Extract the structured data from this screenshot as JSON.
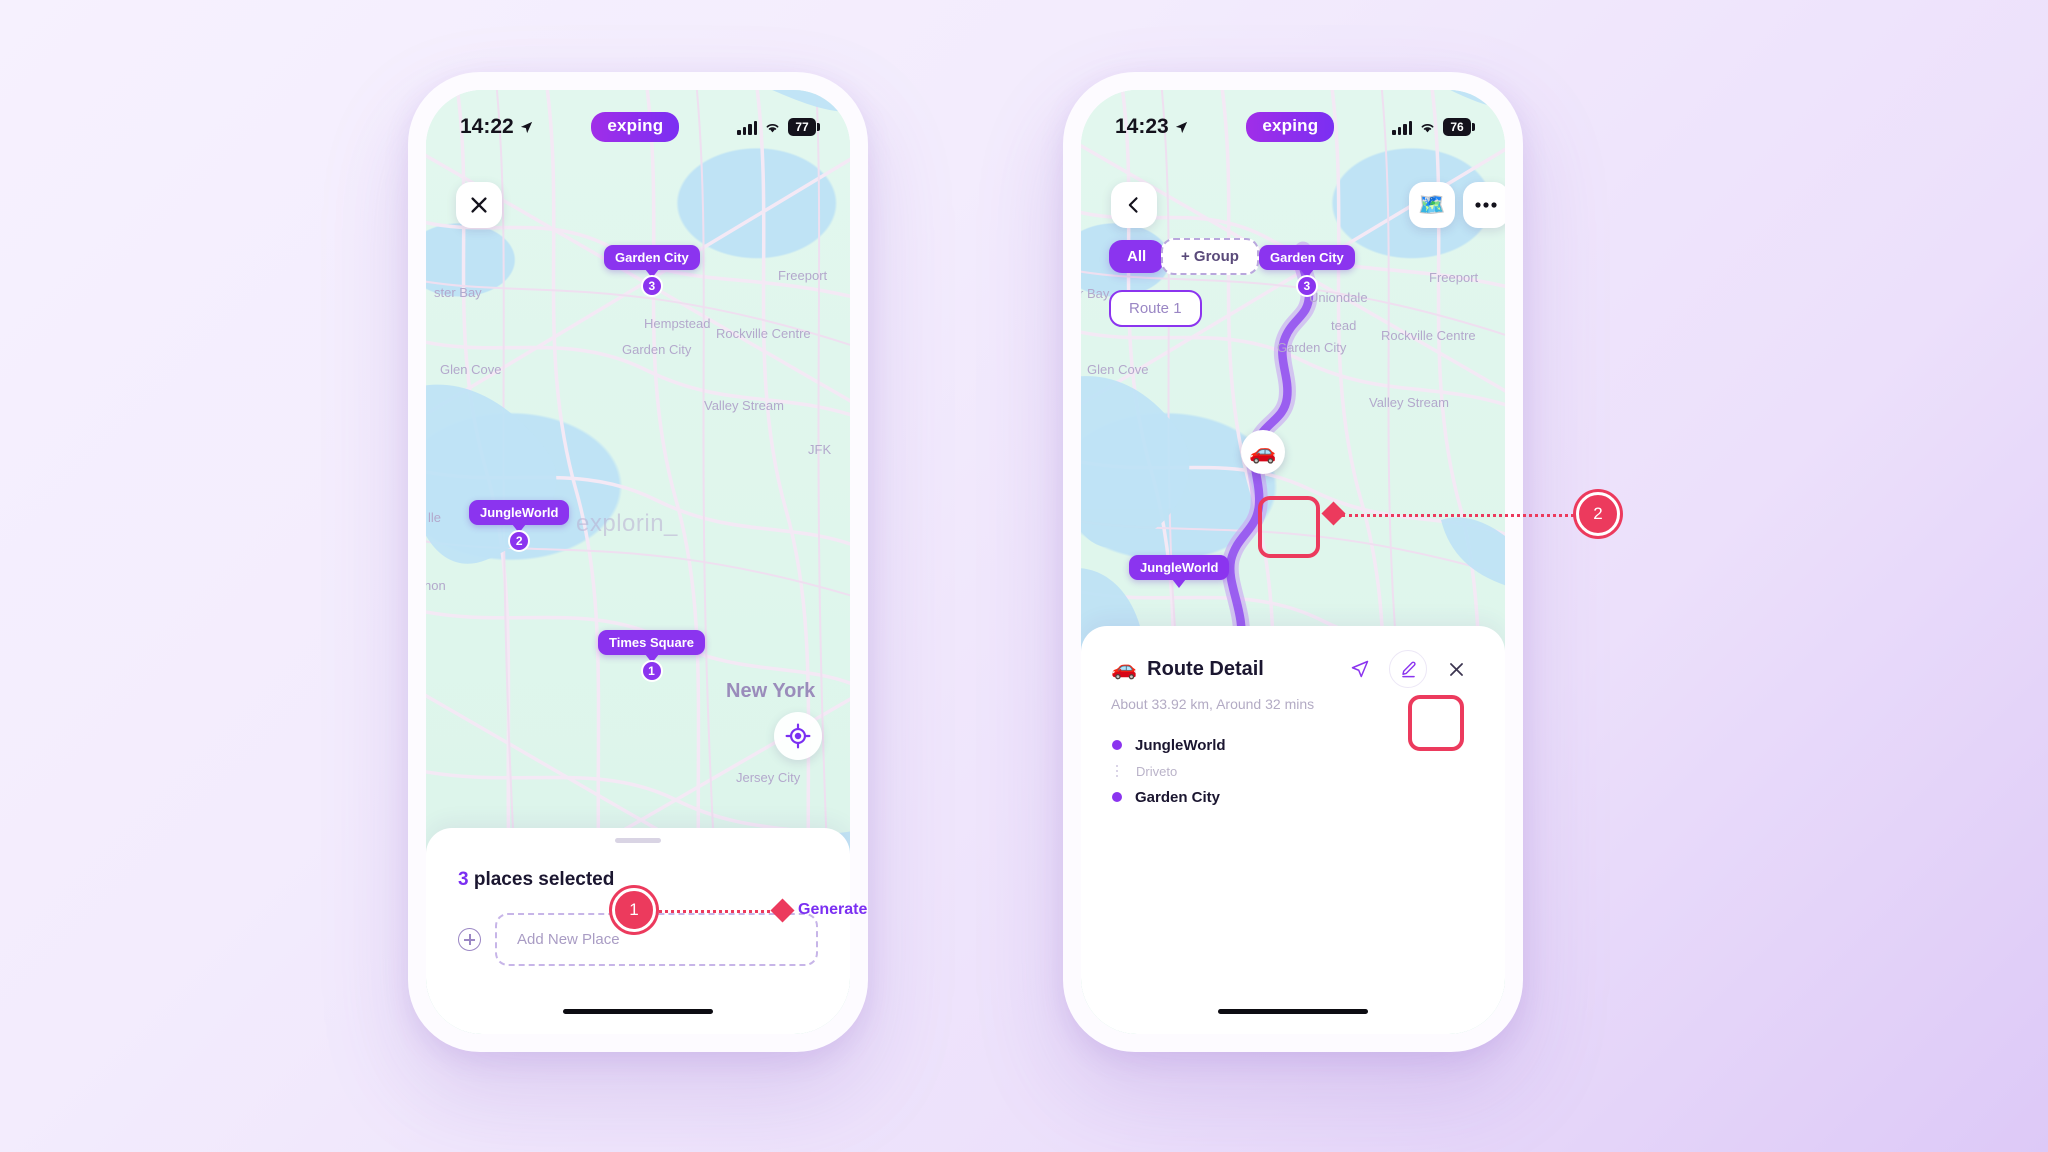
{
  "app": {
    "brand": "exping",
    "watermark": "explorin_"
  },
  "phone1": {
    "status": {
      "time": "14:22",
      "battery": "77",
      "location_icon": "location-arrow-icon",
      "signal_icon": "signal-bars-icon",
      "wifi_icon": "wifi-icon"
    },
    "controls": {
      "close_icon": "close-icon",
      "locate_icon": "locate-crosshair-icon"
    },
    "pins": [
      {
        "label": "Garden City",
        "number": "3"
      },
      {
        "label": "JungleWorld",
        "number": "2"
      },
      {
        "label": "Times Square",
        "number": "1"
      }
    ],
    "map_labels": [
      "ster Bay",
      "Freeport",
      "Glen Cove",
      "Rockville Centre",
      "Hempstead",
      "Garden City",
      "Valley Stream",
      "JFK",
      "New York",
      "Jersey City",
      "non",
      "lle"
    ],
    "sheet": {
      "count": "3",
      "count_suffix": " places selected",
      "add_placeholder": "Add New Place",
      "add_icon": "plus-circle-icon"
    }
  },
  "phone2": {
    "status": {
      "time": "14:23",
      "battery": "76",
      "location_icon": "location-arrow-icon",
      "signal_icon": "signal-bars-icon",
      "wifi_icon": "wifi-icon"
    },
    "controls": {
      "back_icon": "chevron-left-icon",
      "map_icon": "map-layers-icon",
      "more_icon": "more-horizontal-icon"
    },
    "chips": {
      "all": "All",
      "group": "+ Group",
      "route": "Route 1"
    },
    "pins": [
      {
        "label": "Garden City",
        "number": "3"
      },
      {
        "label": "JungleWorld",
        "number": ""
      }
    ],
    "car_marker_icon": "car-icon",
    "map_labels": [
      "Freeport",
      "Uniondale",
      "Rockville Centre",
      "Valley Stream",
      "Glen Cove",
      "Garden City",
      "tead",
      "r Bay"
    ],
    "route_detail": {
      "icon": "car-icon",
      "title": "Route Detail",
      "subtitle": "About 33.92 km, Around 32 mins",
      "send_icon": "send-icon",
      "edit_icon": "pencil-icon",
      "close_icon": "close-icon",
      "stops": [
        {
          "type": "place",
          "name": "JungleWorld"
        },
        {
          "type": "mode",
          "name": "Driveto"
        },
        {
          "type": "place",
          "name": "Garden City"
        }
      ]
    }
  },
  "annotations": [
    {
      "id": "1",
      "label": "Generate",
      "target": "generate-button"
    },
    {
      "id": "2",
      "label": "",
      "target": "car-marker"
    }
  ],
  "colors": {
    "accent_purple": "#8b34ef",
    "brand_purple": "#7b2ff2",
    "annotation_red": "#ec3a5d",
    "map_land": "#dff5ec",
    "map_water": "#bfe3f5"
  }
}
